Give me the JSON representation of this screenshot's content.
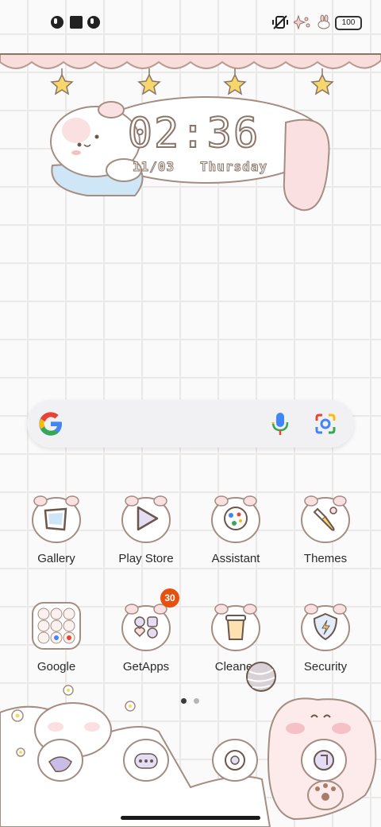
{
  "status_bar": {
    "battery_level": "100",
    "icons": [
      "notification-app-icon",
      "notification-square-icon",
      "notification-app-icon",
      "vibrate-off-icon",
      "sparkle-decoration-icon",
      "bunny-decoration-icon",
      "battery-icon"
    ]
  },
  "clock": {
    "time": "02:36",
    "date": "11/03",
    "weekday": "Thursday"
  },
  "search": {
    "icons": [
      "google-g-icon",
      "microphone-icon",
      "google-lens-icon"
    ]
  },
  "apps_row1": [
    {
      "label": "Gallery"
    },
    {
      "label": "Play Store"
    },
    {
      "label": "Assistant"
    },
    {
      "label": "Themes"
    }
  ],
  "apps_row2": [
    {
      "label": "Google"
    },
    {
      "label": "GetApps"
    },
    {
      "label": "Cleaner"
    },
    {
      "label": "Security"
    }
  ],
  "getapps_badge": "30",
  "page_indicator": {
    "pages": 2,
    "current": 1
  },
  "colors": {
    "badge": "#e5510f",
    "outline": "#8a7568",
    "pink": "#f6cfd2",
    "star": "#f7d66b"
  }
}
